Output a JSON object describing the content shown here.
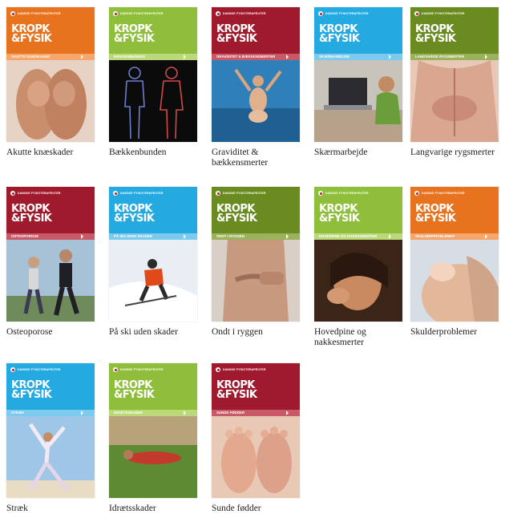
{
  "brand_text": "DANSKE FYSIOTERAPEUTER",
  "logo_line1": "KROPK",
  "logo_line2": "&FYSIK",
  "cards": [
    {
      "title": "Akutte knæskader",
      "strip": "AKUTTE KNÆSKADER",
      "theme": "orange",
      "photo": "knees-photo"
    },
    {
      "title": "Bækkenbunden",
      "strip": "BÆKKENBUNDEN",
      "theme": "green",
      "photo": "pelvic-figures-photo"
    },
    {
      "title": "Graviditet & bækkensmerter",
      "strip": "GRAVIDITET & BÆKKENSMERTER",
      "theme": "red",
      "photo": "pregnant-woman-sea-photo"
    },
    {
      "title": "Skærmarbejde",
      "strip": "SKÆRMARBEJDE",
      "theme": "blue",
      "photo": "laptop-work-photo"
    },
    {
      "title": "Langvarige rygsmerter",
      "strip": "LANGVARIGE RYGSMERTER",
      "theme": "olive",
      "photo": "lower-back-photo"
    },
    {
      "title": "Osteoporose",
      "strip": "OSTEOPOROSE",
      "theme": "red",
      "photo": "joggers-photo"
    },
    {
      "title": "På ski uden skader",
      "strip": "PÅ SKI UDEN SKADER",
      "theme": "blue",
      "photo": "skier-photo"
    },
    {
      "title": "Ondt i ryggen",
      "strip": "ONDT I RYGGEN",
      "theme": "olive",
      "photo": "back-pain-photo"
    },
    {
      "title": "Hovedpine og nakkesmerter",
      "strip": "HOVEDPINE OG NAKKESMERTER",
      "theme": "green",
      "photo": "headache-photo"
    },
    {
      "title": "Skulderproblemer",
      "strip": "SKULDERPROBLEMER",
      "theme": "orange",
      "photo": "shoulder-photo"
    },
    {
      "title": "Stræk",
      "strip": "STRÆK",
      "theme": "blue",
      "photo": "stretching-photo"
    },
    {
      "title": "Idrætsskader",
      "strip": "IDRÆTSSKADER",
      "theme": "green",
      "photo": "sports-injury-photo"
    },
    {
      "title": "Sunde fødder",
      "strip": "SUNDE FØDDER",
      "theme": "red",
      "photo": "feet-photo"
    }
  ]
}
